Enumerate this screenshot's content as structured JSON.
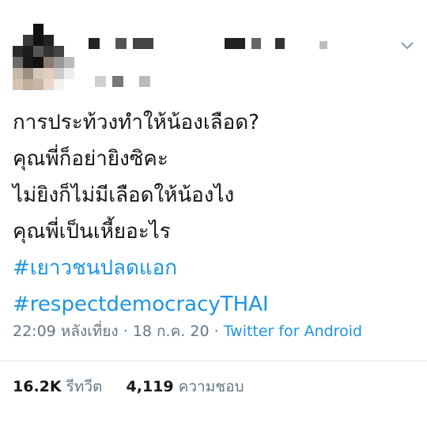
{
  "tweet": {
    "lines": [
      "การประท้วงทำให้น้องเลือด?",
      "คุณพี่ก็อย่ายิงซิคะ",
      "ไม่ยิงก็ไม่มีเลือดให้น้องไง",
      "คุณพี่เป็นเหี้ยอะไร"
    ],
    "hashtags": [
      "#เยาวชนปลดแอก",
      "#respectdemocracyTHAI"
    ],
    "time": "22:09 หลังเที่ยง",
    "date": "18 ก.ค. 20",
    "separator": "·",
    "source": "Twitter for Android"
  },
  "stats": {
    "retweets_count": "16.2K",
    "retweets_label": "รีทวีต",
    "likes_count": "4,119",
    "likes_label": "ความชอบ"
  },
  "icons": {
    "menu": "chevron-down-icon"
  },
  "colors": {
    "text": "#14171a",
    "secondary": "#657786",
    "link": "#1b95e0",
    "divider": "#e1e8ed"
  }
}
